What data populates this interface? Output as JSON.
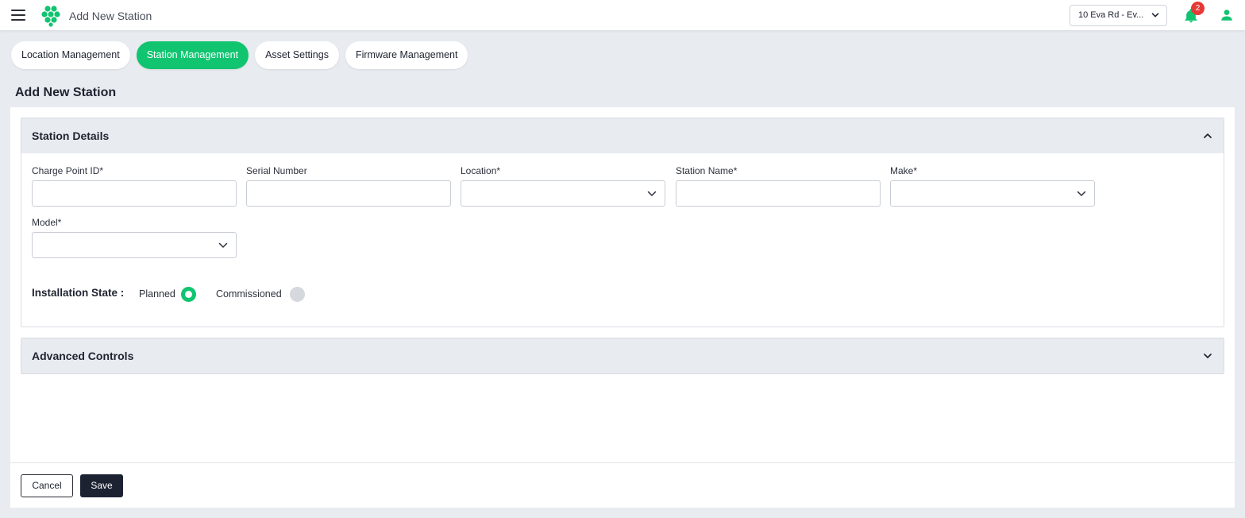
{
  "header": {
    "app_title": "Add New Station",
    "location_selector": "10 Eva Rd - Ev...",
    "notification_count": "2",
    "menu_icon": "hamburger-menu-icon",
    "logo_icon": "hexagon-cluster-logo",
    "notification_icon": "bell-icon",
    "user_icon": "user-icon"
  },
  "tabs": [
    {
      "label": "Location Management",
      "active": false
    },
    {
      "label": "Station Management",
      "active": true
    },
    {
      "label": "Asset Settings",
      "active": false
    },
    {
      "label": "Firmware Management",
      "active": false
    }
  ],
  "page_title": "Add New Station",
  "station_details": {
    "title": "Station Details",
    "expanded": true,
    "fields": {
      "charge_point_id": {
        "label": "Charge Point ID*",
        "value": ""
      },
      "serial_number": {
        "label": "Serial Number",
        "value": ""
      },
      "location": {
        "label": "Location*",
        "value": ""
      },
      "station_name": {
        "label": "Station Name*",
        "value": ""
      },
      "make": {
        "label": "Make*",
        "value": ""
      },
      "model": {
        "label": "Model*",
        "value": ""
      }
    },
    "installation_state": {
      "label": "Installation State :",
      "options": [
        {
          "label": "Planned",
          "selected": true
        },
        {
          "label": "Commissioned",
          "selected": false
        }
      ]
    }
  },
  "advanced_controls": {
    "title": "Advanced Controls",
    "expanded": false
  },
  "actions": {
    "cancel_label": "Cancel",
    "save_label": "Save"
  },
  "colors": {
    "accent": "#10c470",
    "primary_dark": "#1d2233",
    "badge": "#e53935",
    "background": "#e8ebef"
  }
}
